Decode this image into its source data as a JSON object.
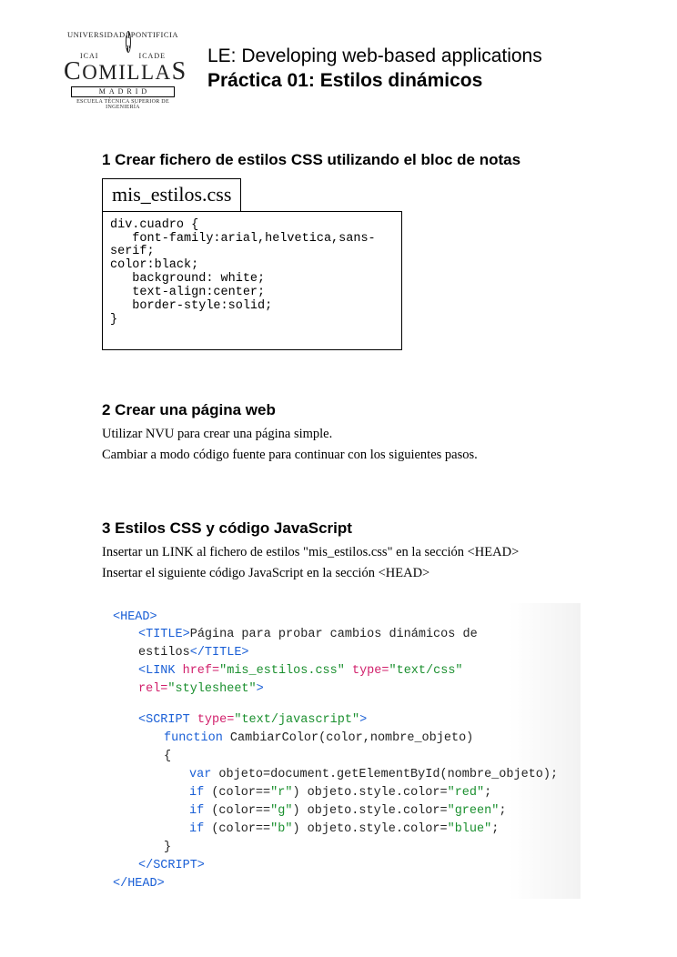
{
  "logo": {
    "top_left": "UNIVERSIDAD",
    "top_right": "PONTIFICIA",
    "mid_left": "ICAI",
    "mid_right": "ICADE",
    "name_html": "COMILLAS",
    "madrid": "MADRID",
    "school": "ESCUELA TÉCNICA SUPERIOR DE INGENIERÍA"
  },
  "header": {
    "line1": "LE: Developing web-based applications",
    "line2": "Práctica 01: Estilos dinámicos"
  },
  "sec1": {
    "title": "1 Crear fichero de estilos CSS utilizando el bloc de notas",
    "filename": "mis_estilos.css",
    "code": "div.cuadro {\n   font-family:arial,helvetica,sans-\nserif;\ncolor:black;\n   background: white;\n   text-align:center;\n   border-style:solid;\n}"
  },
  "sec2": {
    "title": "2 Crear una página web",
    "p1": "Utilizar NVU para crear una página simple.",
    "p2": "Cambiar a modo código fuente para continuar con los siguientes pasos."
  },
  "sec3": {
    "title": "3 Estilos CSS y código JavaScript",
    "p1": "Insertar un LINK al fichero de estilos \"mis_estilos.css\" en la sección <HEAD>",
    "p2": "Insertar el siguiente código JavaScript en la sección <HEAD>"
  },
  "code3": {
    "title_text": "Página para probar cambios dinámicos de estilos",
    "link_href": "mis_estilos.css",
    "link_type": "text/css",
    "link_rel": "stylesheet",
    "script_type": "text/javascript",
    "func_sig": "CambiarColor(color,nombre_objeto)",
    "var_line": "objeto=document.getElementById(nombre_objeto);",
    "if_r_cond": "color==",
    "r_lit": "\"r\"",
    "g_lit": "\"g\"",
    "b_lit": "\"b\"",
    "assign": "objeto.style.color=",
    "red": "\"red\"",
    "green": "\"green\"",
    "blue": "\"blue\""
  }
}
